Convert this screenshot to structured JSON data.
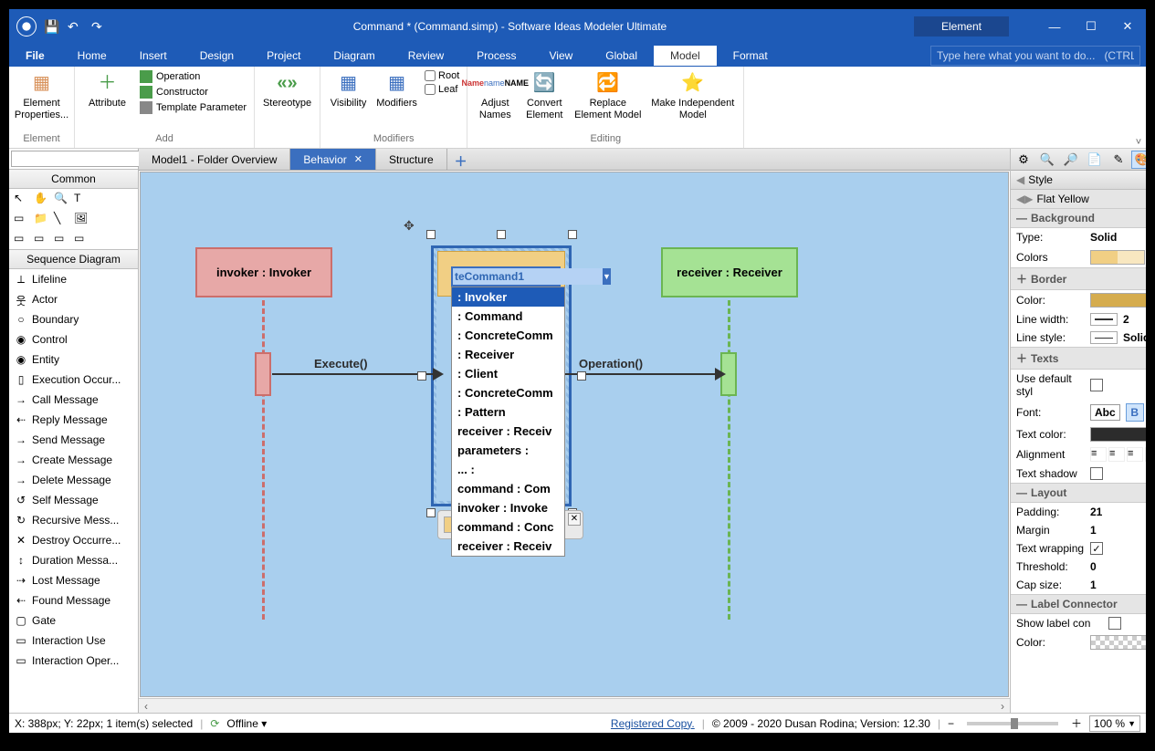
{
  "title": "Command * (Command.simp) - Software Ideas Modeler Ultimate",
  "contextTab": "Element",
  "menus": [
    "File",
    "Home",
    "Insert",
    "Design",
    "Project",
    "Diagram",
    "Review",
    "Process",
    "View",
    "Global",
    "Model",
    "Format"
  ],
  "activeMenu": "Model",
  "searchPlaceholder": "Type here what you want to do...   (CTRL+Q)",
  "ribbon": {
    "elementGroup": {
      "label": "Element",
      "btn": "Element Properties..."
    },
    "addGroup": {
      "label": "Add",
      "attr": "Attribute",
      "op": "Operation",
      "cons": "Constructor",
      "tmpl": "Template Parameter"
    },
    "stereotype": "Stereotype",
    "modGroup": {
      "label": "Modifiers",
      "vis": "Visibility",
      "mod": "Modifiers",
      "root": "Root",
      "leaf": "Leaf"
    },
    "editGroup": {
      "label": "Editing",
      "adjust": "Adjust Names",
      "convert": "Convert Element",
      "replace": "Replace Element Model",
      "indep": "Make Independent Model"
    }
  },
  "leftHeader": "Common",
  "seqHeader": "Sequence Diagram",
  "tools": [
    "Lifeline",
    "Actor",
    "Boundary",
    "Control",
    "Entity",
    "Execution Occur...",
    "Call Message",
    "Reply Message",
    "Send Message",
    "Create Message",
    "Delete Message",
    "Self Message",
    "Recursive Mess...",
    "Destroy Occurre...",
    "Duration Messa...",
    "Lost Message",
    "Found Message",
    "Gate",
    "Interaction Use",
    "Interaction Oper..."
  ],
  "docTabs": [
    {
      "label": "Model1 - Folder Overview",
      "active": false
    },
    {
      "label": "Behavior",
      "active": true
    },
    {
      "label": "Structure",
      "active": false
    }
  ],
  "lifelines": {
    "l1": "invoker : Invoker",
    "l3": "receiver : Receiver"
  },
  "messages": {
    "m1": "Execute()",
    "m2": "Operation()"
  },
  "editValue": "teCommand1",
  "dropdown": [
    ": Invoker",
    ": Command",
    ": ConcreteComm",
    ": Receiver",
    ": Client",
    ": ConcreteComm",
    ": Pattern",
    "receiver : Receiv",
    "parameters :",
    "... :",
    "command : Com",
    "invoker : Invoke",
    "command : Conc",
    "receiver : Receiv"
  ],
  "style": {
    "title": "Style",
    "theme": "Flat Yellow",
    "background": "Background",
    "type": {
      "l": "Type:",
      "v": "Solid"
    },
    "colors": "Colors",
    "border": "Border",
    "color": "Color:",
    "linewidth": {
      "l": "Line width:",
      "v": "2"
    },
    "linestyle": {
      "l": "Line style:",
      "v": "Solid"
    },
    "texts": "Texts",
    "usedef": "Use default styl",
    "font": {
      "l": "Font:",
      "v": "Abc"
    },
    "textcolor": "Text color:",
    "alignment": "Alignment",
    "textshadow": "Text shadow",
    "layout": "Layout",
    "padding": {
      "l": "Padding:",
      "v": "21"
    },
    "margin": {
      "l": "Margin",
      "v": "1"
    },
    "textwrap": "Text wrapping",
    "threshold": {
      "l": "Threshold:",
      "v": "0"
    },
    "capsize": {
      "l": "Cap size:",
      "v": "1"
    },
    "labelcon": "Label Connector",
    "showlabel": "Show label con",
    "color2": "Color:"
  },
  "status": {
    "pos": "X: 388px; Y: 22px; 1 item(s) selected",
    "offline": "Offline",
    "registered": "Registered Copy.",
    "copyright": "© 2009 - 2020 Dusan Rodina; Version: 12.30",
    "zoom": "100 %"
  }
}
